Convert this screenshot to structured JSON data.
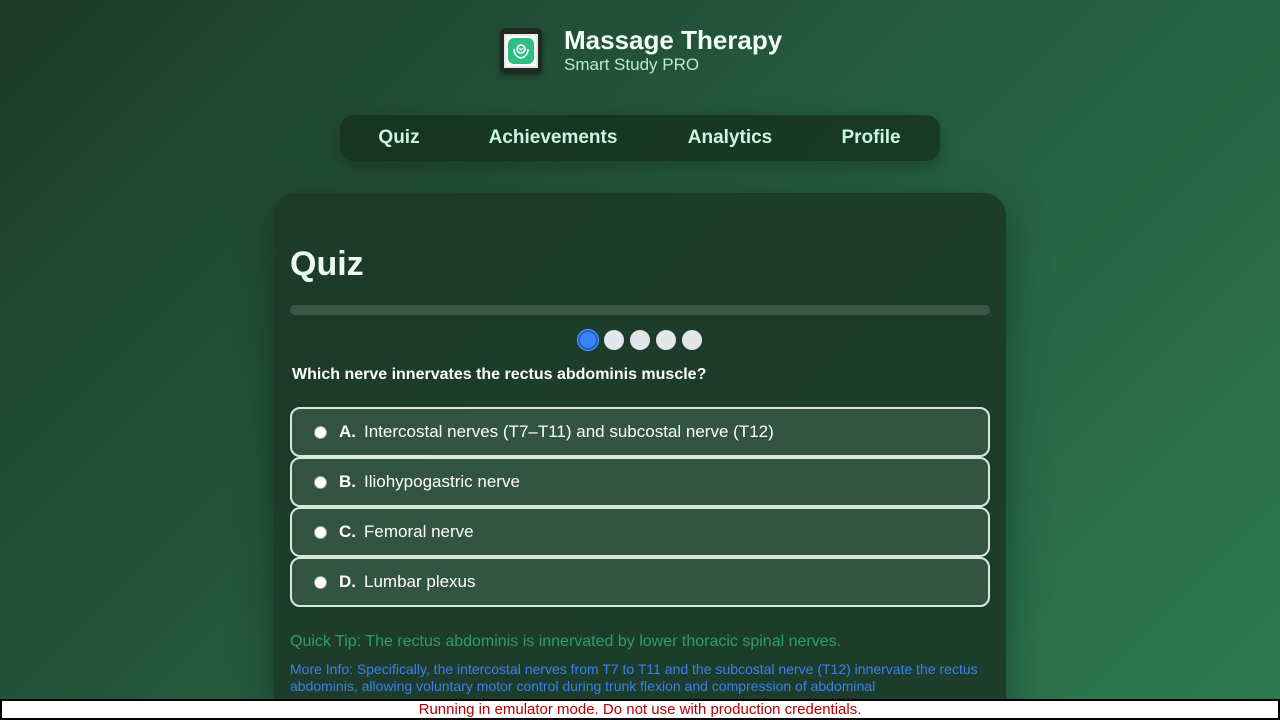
{
  "header": {
    "logo_icon": "massage-hands-icon",
    "title": "Massage Therapy",
    "subtitle": "Smart Study PRO"
  },
  "nav": {
    "items": [
      {
        "label": "Quiz"
      },
      {
        "label": "Achievements"
      },
      {
        "label": "Analytics"
      },
      {
        "label": "Profile"
      }
    ]
  },
  "quiz": {
    "title": "Quiz",
    "progress": 0,
    "current_question": 1,
    "total_questions": 5,
    "question": "Which nerve innervates the rectus abdominis muscle?",
    "options": [
      {
        "letter": "A.",
        "text": "Intercostal nerves (T7–T11) and subcostal nerve (T12)"
      },
      {
        "letter": "B.",
        "text": "Iliohypogastric nerve"
      },
      {
        "letter": "C.",
        "text": "Femoral nerve"
      },
      {
        "letter": "D.",
        "text": "Lumbar plexus"
      }
    ],
    "tip": "Quick Tip: The rectus abdominis is innervated by lower thoracic spinal nerves.",
    "more_info": "More Info: Specifically, the intercostal nerves from T7 to T11 and the subcostal nerve (T12) innervate the rectus abdominis, allowing voluntary motor control during trunk flexion and compression of abdominal"
  },
  "emulator_notice": "Running in emulator mode. Do not use with production credentials.",
  "colors": {
    "accent_blue": "#3b82f6",
    "tip_green": "#2f9e66",
    "info_blue": "#3d7ff0",
    "warning_red": "#b30000"
  }
}
